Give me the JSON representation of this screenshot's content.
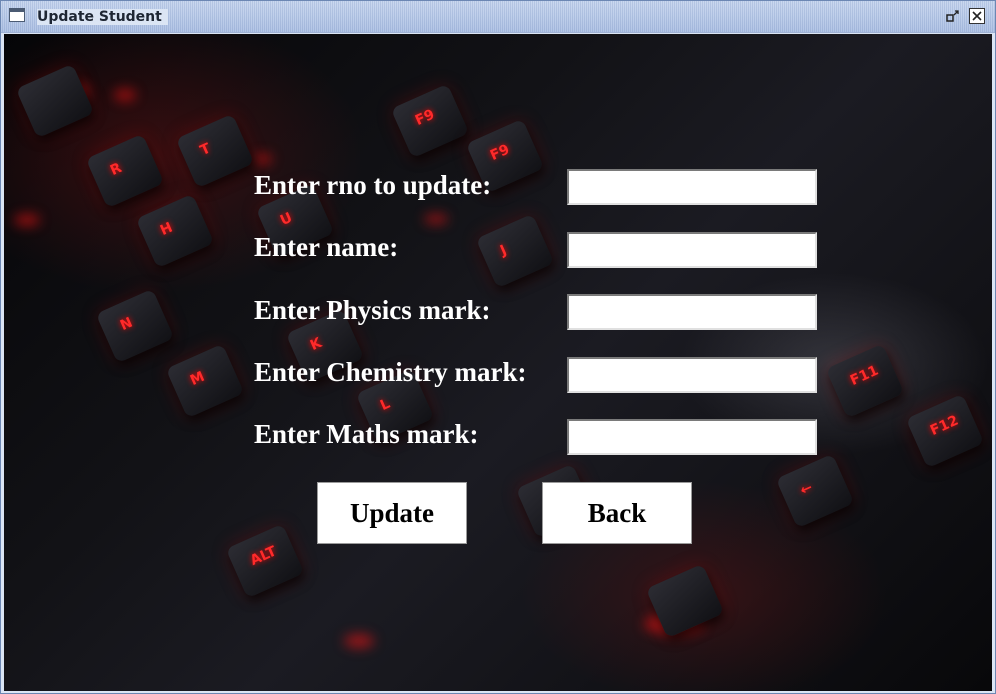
{
  "window": {
    "title": "Update Student"
  },
  "form": {
    "rno_label": "Enter rno to update:",
    "name_label": "Enter name:",
    "physics_label": "Enter Physics mark:",
    "chemistry_label": "Enter Chemistry mark:",
    "maths_label": "Enter Maths mark:",
    "rno_value": "",
    "name_value": "",
    "physics_value": "",
    "chemistry_value": "",
    "maths_value": ""
  },
  "buttons": {
    "update_label": "Update",
    "back_label": "Back"
  },
  "icons": {
    "app": "window-icon",
    "restore": "restore-icon",
    "close": "close-icon"
  },
  "background": {
    "key_legends": [
      "F9",
      "H",
      "N",
      "M",
      "U",
      "J",
      "K",
      "L",
      "ALT",
      "F11",
      "F12",
      "R",
      "T"
    ]
  }
}
